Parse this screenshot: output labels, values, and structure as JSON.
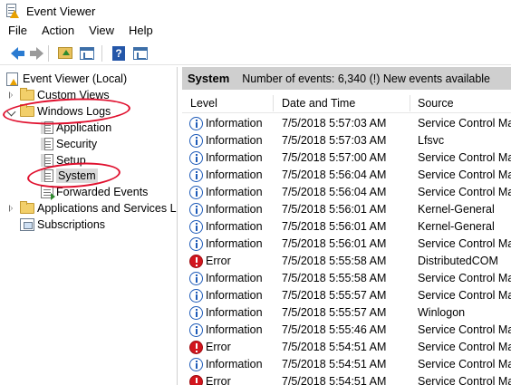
{
  "window": {
    "title": "Event Viewer"
  },
  "menu": [
    "File",
    "Action",
    "View",
    "Help"
  ],
  "toolbar": {
    "buttons": [
      "back-icon",
      "forward-icon",
      "up-folder-icon",
      "show-hide-tree-icon",
      "help-icon",
      "show-hide-action-pane-icon"
    ]
  },
  "tree": {
    "root": "Event Viewer (Local)",
    "custom_views": "Custom Views",
    "windows_logs": "Windows Logs",
    "application": "Application",
    "security": "Security",
    "setup": "Setup",
    "system": "System",
    "forwarded_events": "Forwarded Events",
    "apps_services": "Applications and Services Lo",
    "subscriptions": "Subscriptions"
  },
  "pane": {
    "title": "System",
    "summary": "Number of events: 6,340 (!) New events available"
  },
  "columns": [
    "Level",
    "Date and Time",
    "Source"
  ],
  "events": [
    {
      "level": "Information",
      "type": "info",
      "datetime": "7/5/2018 5:57:03 AM",
      "source": "Service Control Mar"
    },
    {
      "level": "Information",
      "type": "info",
      "datetime": "7/5/2018 5:57:03 AM",
      "source": "Lfsvc"
    },
    {
      "level": "Information",
      "type": "info",
      "datetime": "7/5/2018 5:57:00 AM",
      "source": "Service Control Mar"
    },
    {
      "level": "Information",
      "type": "info",
      "datetime": "7/5/2018 5:56:04 AM",
      "source": "Service Control Mar"
    },
    {
      "level": "Information",
      "type": "info",
      "datetime": "7/5/2018 5:56:04 AM",
      "source": "Service Control Mar"
    },
    {
      "level": "Information",
      "type": "info",
      "datetime": "7/5/2018 5:56:01 AM",
      "source": "Kernel-General"
    },
    {
      "level": "Information",
      "type": "info",
      "datetime": "7/5/2018 5:56:01 AM",
      "source": "Kernel-General"
    },
    {
      "level": "Information",
      "type": "info",
      "datetime": "7/5/2018 5:56:01 AM",
      "source": "Service Control Mar"
    },
    {
      "level": "Error",
      "type": "error",
      "datetime": "7/5/2018 5:55:58 AM",
      "source": "DistributedCOM"
    },
    {
      "level": "Information",
      "type": "info",
      "datetime": "7/5/2018 5:55:58 AM",
      "source": "Service Control Mar"
    },
    {
      "level": "Information",
      "type": "info",
      "datetime": "7/5/2018 5:55:57 AM",
      "source": "Service Control Mar"
    },
    {
      "level": "Information",
      "type": "info",
      "datetime": "7/5/2018 5:55:57 AM",
      "source": "Winlogon"
    },
    {
      "level": "Information",
      "type": "info",
      "datetime": "7/5/2018 5:55:46 AM",
      "source": "Service Control Mar"
    },
    {
      "level": "Error",
      "type": "error",
      "datetime": "7/5/2018 5:54:51 AM",
      "source": "Service Control Mar"
    },
    {
      "level": "Information",
      "type": "info",
      "datetime": "7/5/2018 5:54:51 AM",
      "source": "Service Control Mar"
    },
    {
      "level": "Error",
      "type": "error",
      "datetime": "7/5/2018 5:54:51 AM",
      "source": "Service Control Mar"
    }
  ],
  "annotation_color": "#e0102e"
}
